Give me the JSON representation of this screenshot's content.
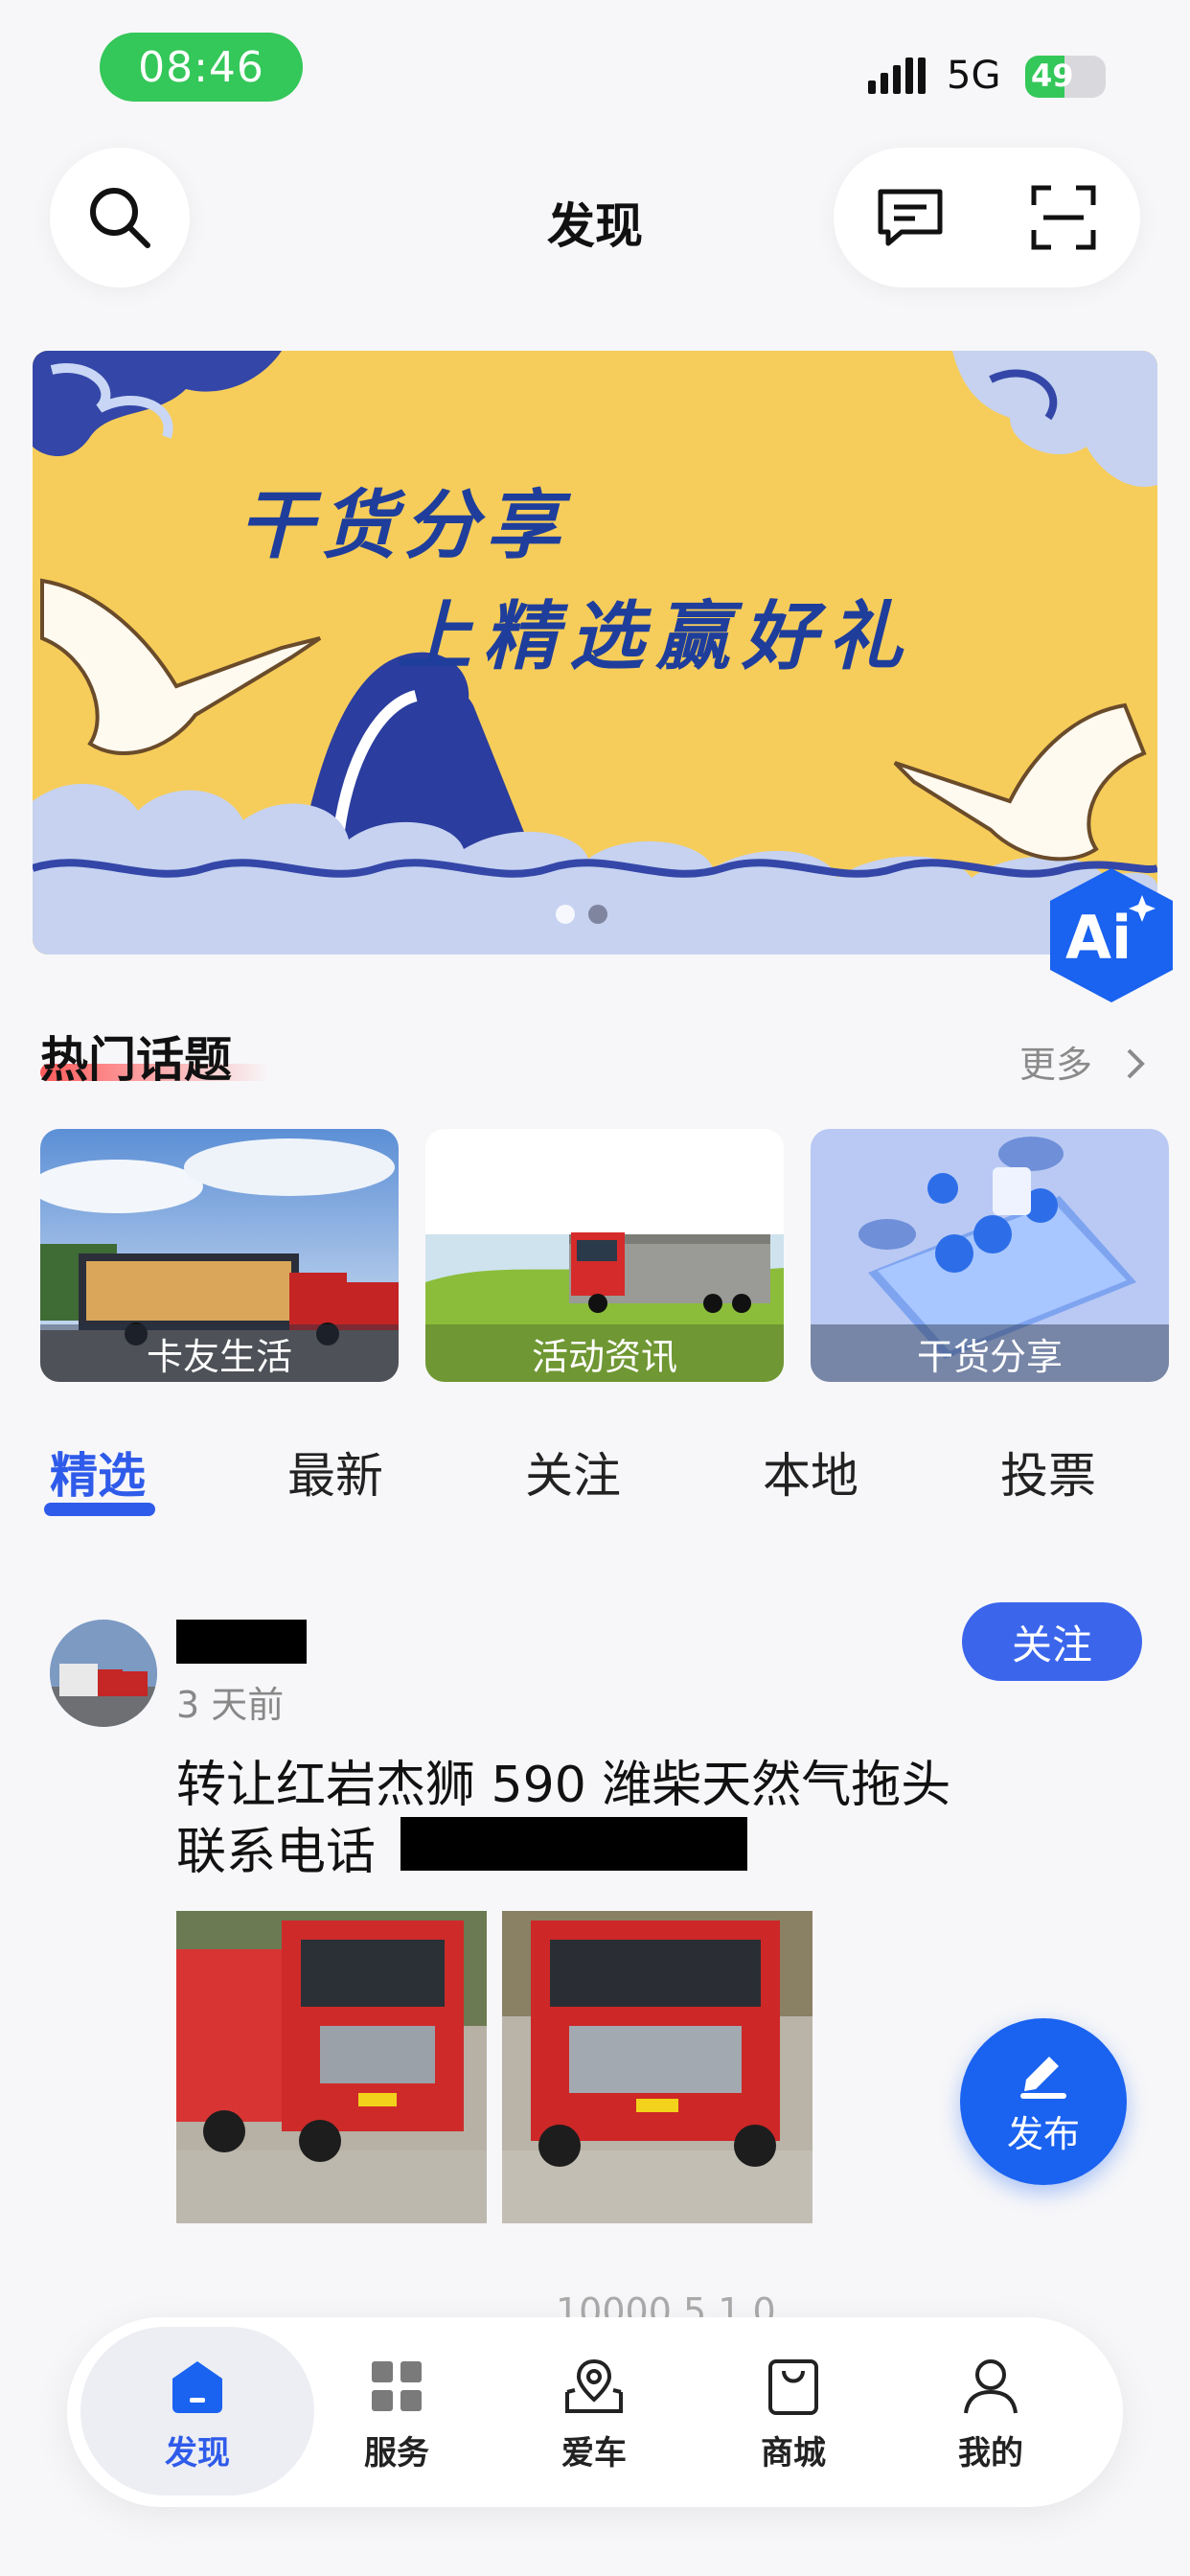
{
  "status": {
    "time": "08:46",
    "network": "5G",
    "battery": "49",
    "battery_level": 0.49
  },
  "header": {
    "title": "发现",
    "search_icon": "search-icon",
    "message_icon": "message-icon",
    "scan_icon": "scan-icon"
  },
  "banner": {
    "line1": "干货分享",
    "line2": "上精选赢好礼",
    "slide_count": 2,
    "active_slide": 1
  },
  "ai_badge": {
    "label": "Ai"
  },
  "hot_topics": {
    "title": "热门话题",
    "more_label": "更多",
    "cards": [
      {
        "label": "卡友生活"
      },
      {
        "label": "活动资讯"
      },
      {
        "label": "干货分享"
      }
    ]
  },
  "tabs": [
    {
      "label": "精选",
      "active": true
    },
    {
      "label": "最新",
      "active": false
    },
    {
      "label": "关注",
      "active": false
    },
    {
      "label": "本地",
      "active": false
    },
    {
      "label": "投票",
      "active": false
    }
  ],
  "post": {
    "time_ago": "3 天前",
    "follow_label": "关注",
    "line1": "转让红岩杰狮 590 潍柴天然气拖头",
    "line2": "联系电话",
    "stats": "10000   5   1   0"
  },
  "fab": {
    "label": "发布"
  },
  "bottom_nav": [
    {
      "label": "发现",
      "icon": "home-icon",
      "active": true
    },
    {
      "label": "服务",
      "icon": "grid-icon",
      "active": false
    },
    {
      "label": "爱车",
      "icon": "car-location-icon",
      "active": false
    },
    {
      "label": "商城",
      "icon": "shopping-bag-icon",
      "active": false
    },
    {
      "label": "我的",
      "icon": "user-icon",
      "active": false
    }
  ],
  "colors": {
    "accent": "#2f5bea",
    "status_green": "#34c759",
    "banner_bg": "#f6cd5a",
    "banner_text": "#1f3e9c"
  }
}
